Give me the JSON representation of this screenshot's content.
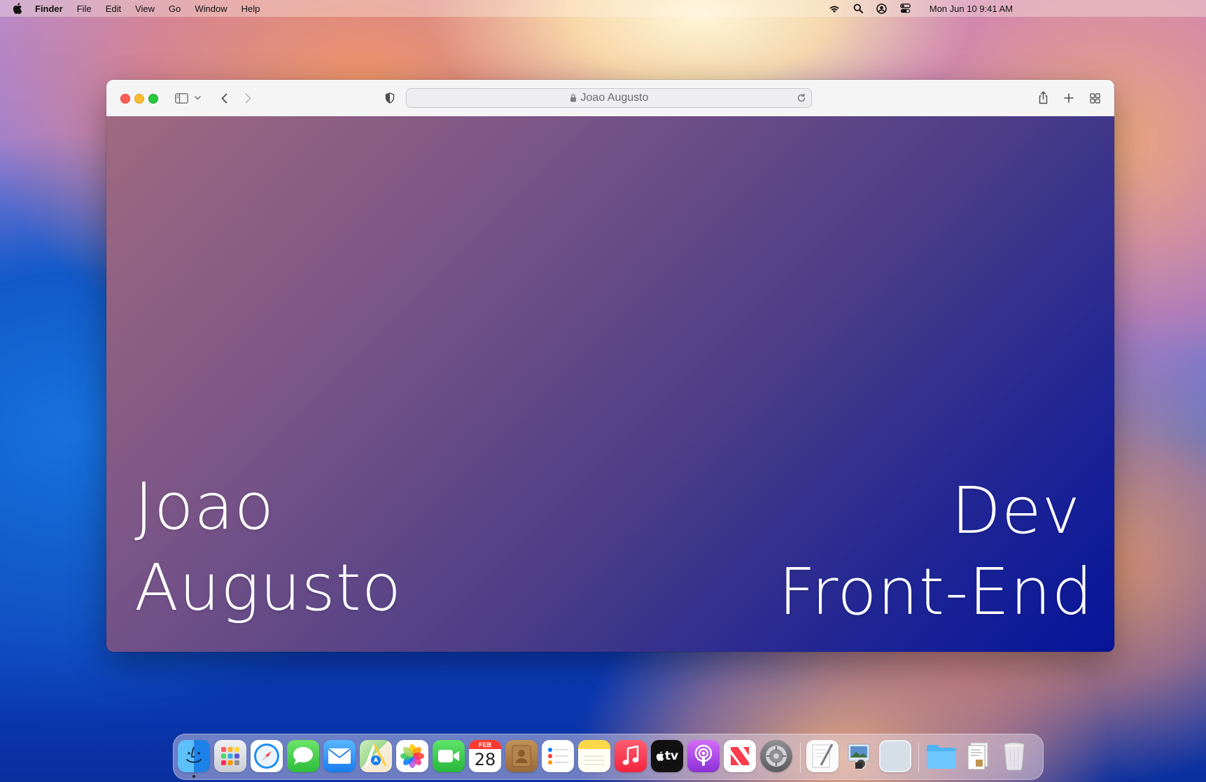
{
  "menubar": {
    "apple_icon": "apple-logo-icon",
    "items": [
      "Finder",
      "File",
      "Edit",
      "View",
      "Go",
      "Window",
      "Help"
    ],
    "status_icons": [
      "wifi-icon",
      "search-icon",
      "user-account-icon",
      "control-center-icon"
    ],
    "clock": "Mon Jun 10  9:41 AM"
  },
  "browser": {
    "address": "Joao Augusto",
    "toolbar_icons": [
      "sidebar-icon",
      "chevron-down-icon",
      "back-icon",
      "forward-icon",
      "privacy-shield-icon",
      "lock-icon",
      "reload-icon",
      "share-icon",
      "new-tab-icon",
      "tab-overview-icon"
    ]
  },
  "page": {
    "name_line1": "Joao",
    "name_line2": "Augusto",
    "role_line1": "Dev",
    "role_line2": "Front-End",
    "gradient_colors": [
      "#a06a80",
      "#061498"
    ]
  },
  "dock": {
    "calendar_month": "FEB",
    "calendar_day": "28",
    "tv_label": "tv",
    "apps": [
      "finder-icon",
      "launchpad-icon",
      "safari-icon",
      "messages-icon",
      "mail-icon",
      "maps-icon",
      "photos-icon",
      "facetime-icon",
      "calendar-icon",
      "contacts-icon",
      "reminders-icon",
      "notes-icon",
      "music-icon",
      "apple-tv-icon",
      "podcasts-icon",
      "news-icon",
      "system-settings-icon",
      "textedit-icon",
      "preview-icon",
      "blank-app-icon",
      "downloads-folder-icon",
      "documents-stack-icon",
      "trash-icon"
    ]
  }
}
